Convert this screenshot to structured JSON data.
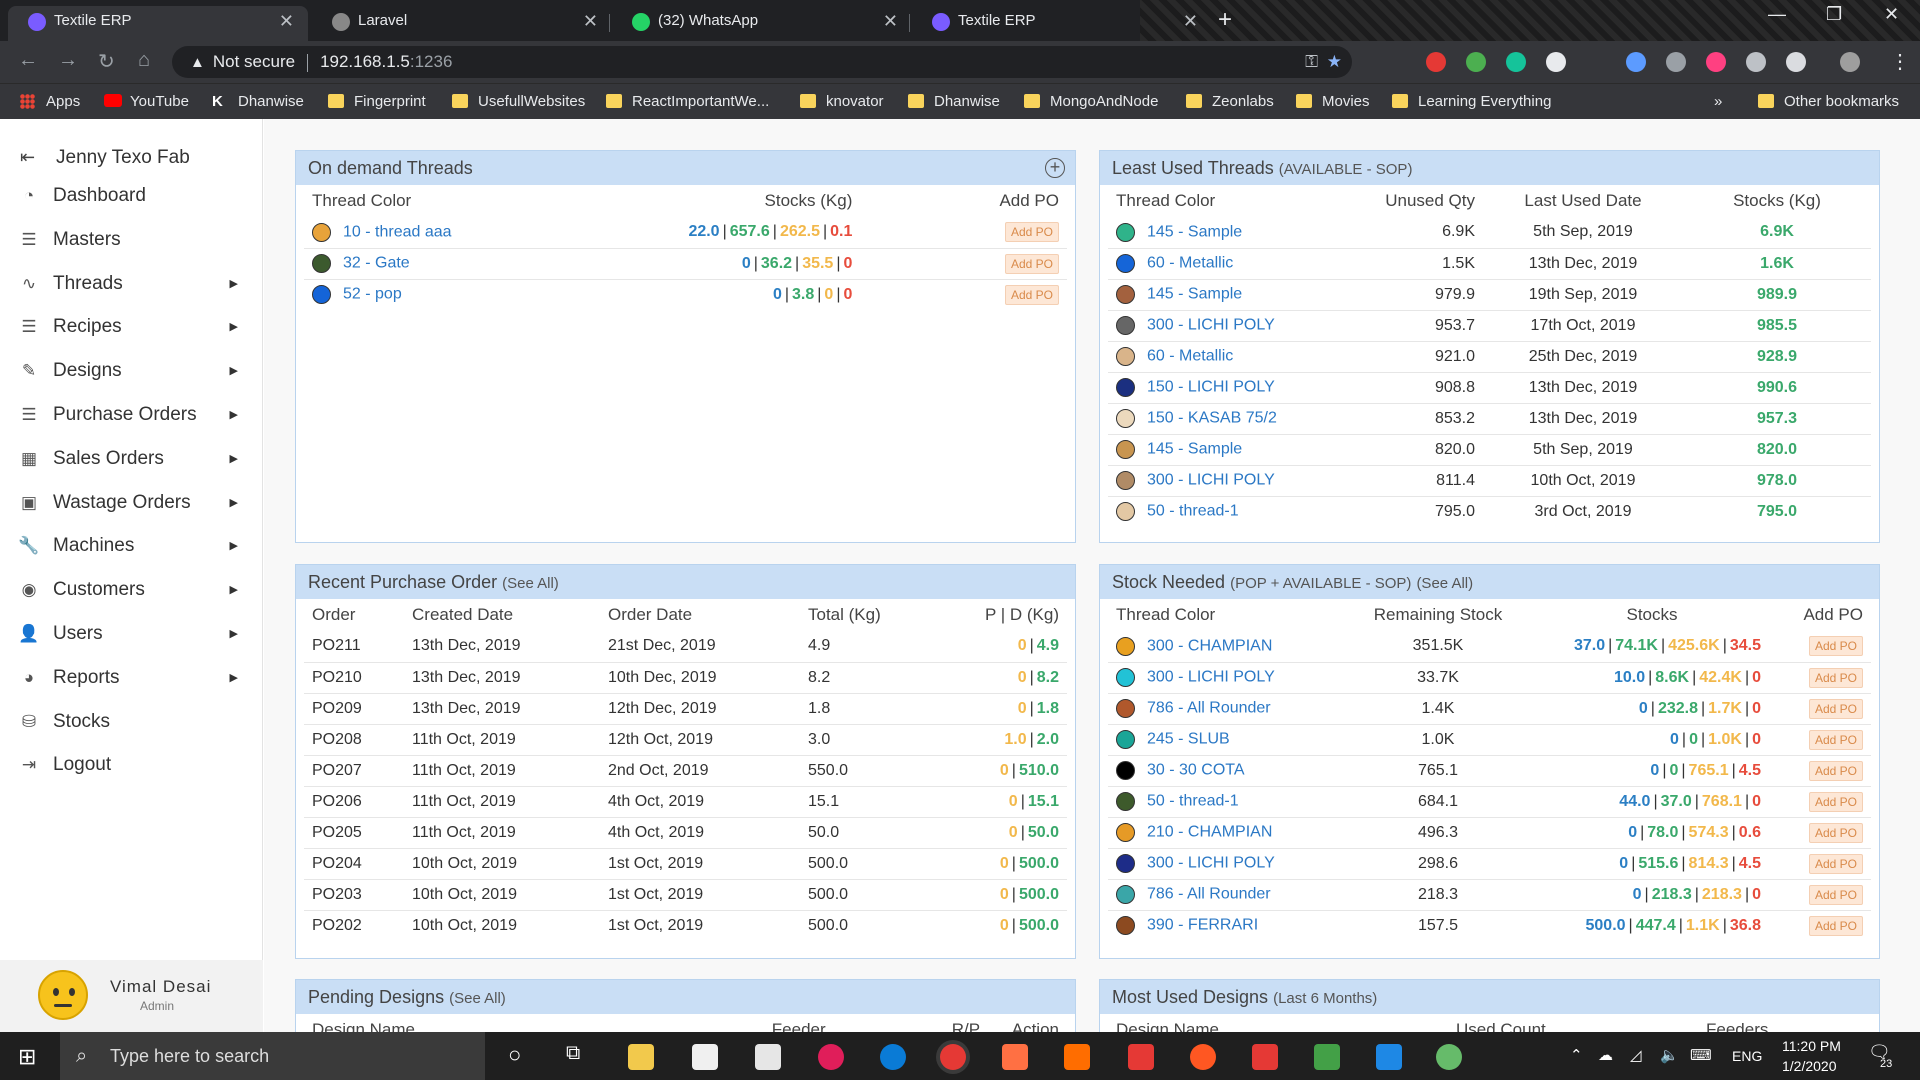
{
  "browser": {
    "tabs": [
      {
        "title": "Textile ERP"
      },
      {
        "title": "Laravel"
      },
      {
        "title": "(32) WhatsApp"
      },
      {
        "title": "Textile ERP"
      }
    ],
    "not_secure": "Not secure",
    "url_host": "192.168.1.5",
    "url_port": ":1236",
    "bookmarks": [
      "Apps",
      "YouTube",
      "Dhanwise",
      "Fingerprint",
      "UsefullWebsites",
      "ReactImportantWe...",
      "knovator",
      "Dhanwise",
      "MongoAndNode",
      "Zeonlabs",
      "Movies",
      "Learning Everything"
    ],
    "other_bookmarks": "Other bookmarks",
    "more": "»"
  },
  "sidebar": {
    "brand": "Jenny Texo Fab",
    "items": [
      {
        "label": "Dashboard",
        "icon": "dashboard-icon",
        "submenu": false
      },
      {
        "label": "Masters",
        "icon": "list-icon",
        "submenu": false
      },
      {
        "label": "Threads",
        "icon": "pulse-icon",
        "submenu": true
      },
      {
        "label": "Recipes",
        "icon": "list-icon",
        "submenu": true
      },
      {
        "label": "Designs",
        "icon": "pen-icon",
        "submenu": true
      },
      {
        "label": "Purchase Orders",
        "icon": "list-icon",
        "submenu": true
      },
      {
        "label": "Sales Orders",
        "icon": "grid-icon",
        "submenu": true
      },
      {
        "label": "Wastage Orders",
        "icon": "box-icon",
        "submenu": true
      },
      {
        "label": "Machines",
        "icon": "wrench-icon",
        "submenu": true
      },
      {
        "label": "Customers",
        "icon": "user-circle-icon",
        "submenu": true
      },
      {
        "label": "Users",
        "icon": "user-icon",
        "submenu": true
      },
      {
        "label": "Reports",
        "icon": "chart-icon",
        "submenu": true
      },
      {
        "label": "Stocks",
        "icon": "database-icon",
        "submenu": false
      },
      {
        "label": "Logout",
        "icon": "logout-icon",
        "submenu": false
      }
    ],
    "user": {
      "name": "Vimal Desai",
      "role": "Admin"
    }
  },
  "on_demand": {
    "title": "On demand Threads",
    "headers": [
      "Thread Color",
      "Stocks (Kg)",
      "Add PO"
    ],
    "rows": [
      {
        "color": "#e8a33a",
        "name": "10 - thread aaa",
        "s": [
          "22.0",
          "657.6",
          "262.5",
          "0.1"
        ],
        "btn": "Add PO"
      },
      {
        "color": "#3c5a2e",
        "name": "32 - Gate",
        "s": [
          "0",
          "36.2",
          "35.5",
          "0"
        ],
        "btn": "Add PO"
      },
      {
        "color": "#1464d8",
        "name": "52 - pop",
        "s": [
          "0",
          "3.8",
          "0",
          "0"
        ],
        "btn": "Add PO"
      }
    ]
  },
  "least_used": {
    "title": "Least Used Threads",
    "subtitle": "(AVAILABLE - SOP)",
    "headers": [
      "Thread Color",
      "Unused Qty",
      "Last Used Date",
      "Stocks (Kg)"
    ],
    "rows": [
      {
        "color": "#2fb38a",
        "name": "145 - Sample",
        "qty": "6.9K",
        "date": "5th Sep, 2019",
        "stock": "6.9K"
      },
      {
        "color": "#1565d8",
        "name": "60 - Metallic",
        "qty": "1.5K",
        "date": "13th Dec, 2019",
        "stock": "1.6K"
      },
      {
        "color": "#a3613e",
        "name": "145 - Sample",
        "qty": "979.9",
        "date": "19th Sep, 2019",
        "stock": "989.9"
      },
      {
        "color": "#666666",
        "name": "300 - LICHI POLY",
        "qty": "953.7",
        "date": "17th Oct, 2019",
        "stock": "985.5"
      },
      {
        "color": "#d9b48a",
        "name": "60 - Metallic",
        "qty": "921.0",
        "date": "25th Dec, 2019",
        "stock": "928.9"
      },
      {
        "color": "#1b2f80",
        "name": "150 - LICHI POLY",
        "qty": "908.8",
        "date": "13th Dec, 2019",
        "stock": "990.6"
      },
      {
        "color": "#ecd9bd",
        "name": "150 - KASAB 75/2",
        "qty": "853.2",
        "date": "13th Dec, 2019",
        "stock": "957.3"
      },
      {
        "color": "#c89550",
        "name": "145 - Sample",
        "qty": "820.0",
        "date": "5th Sep, 2019",
        "stock": "820.0"
      },
      {
        "color": "#b08b66",
        "name": "300 - LICHI POLY",
        "qty": "811.4",
        "date": "10th Oct, 2019",
        "stock": "978.0"
      },
      {
        "color": "#e3c8a4",
        "name": "50 - thread-1",
        "qty": "795.0",
        "date": "3rd Oct, 2019",
        "stock": "795.0"
      }
    ]
  },
  "recent_po": {
    "title": "Recent Purchase Order",
    "see_all": "(See All)",
    "headers": [
      "Order",
      "Created Date",
      "Order Date",
      "Total (Kg)",
      "P | D (Kg)"
    ],
    "rows": [
      {
        "order": "PO211",
        "created": "13th Dec, 2019",
        "date": "21st Dec, 2019",
        "total": "4.9",
        "p": "0",
        "d": "4.9"
      },
      {
        "order": "PO210",
        "created": "13th Dec, 2019",
        "date": "10th Dec, 2019",
        "total": "8.2",
        "p": "0",
        "d": "8.2"
      },
      {
        "order": "PO209",
        "created": "13th Dec, 2019",
        "date": "12th Dec, 2019",
        "total": "1.8",
        "p": "0",
        "d": "1.8"
      },
      {
        "order": "PO208",
        "created": "11th Oct, 2019",
        "date": "12th Oct, 2019",
        "total": "3.0",
        "p": "1.0",
        "d": "2.0"
      },
      {
        "order": "PO207",
        "created": "11th Oct, 2019",
        "date": "2nd Oct, 2019",
        "total": "550.0",
        "p": "0",
        "d": "510.0"
      },
      {
        "order": "PO206",
        "created": "11th Oct, 2019",
        "date": "4th Oct, 2019",
        "total": "15.1",
        "p": "0",
        "d": "15.1"
      },
      {
        "order": "PO205",
        "created": "11th Oct, 2019",
        "date": "4th Oct, 2019",
        "total": "50.0",
        "p": "0",
        "d": "50.0"
      },
      {
        "order": "PO204",
        "created": "10th Oct, 2019",
        "date": "1st Oct, 2019",
        "total": "500.0",
        "p": "0",
        "d": "500.0"
      },
      {
        "order": "PO203",
        "created": "10th Oct, 2019",
        "date": "1st Oct, 2019",
        "total": "500.0",
        "p": "0",
        "d": "500.0"
      },
      {
        "order": "PO202",
        "created": "10th Oct, 2019",
        "date": "1st Oct, 2019",
        "total": "500.0",
        "p": "0",
        "d": "500.0"
      }
    ]
  },
  "stock_needed": {
    "title": "Stock Needed",
    "subtitle": "(POP + AVAILABLE - SOP)",
    "see_all": "(See All)",
    "headers": [
      "Thread Color",
      "Remaining Stock",
      "Stocks",
      "Add PO"
    ],
    "rows": [
      {
        "color": "#e8a020",
        "name": "300 - CHAMPIAN",
        "rem": "351.5K",
        "s": [
          "37.0",
          "74.1K",
          "425.6K",
          "34.5"
        ],
        "btn": "Add PO"
      },
      {
        "color": "#22c2d6",
        "name": "300 - LICHI POLY",
        "rem": "33.7K",
        "s": [
          "10.0",
          "8.6K",
          "42.4K",
          "0"
        ],
        "btn": "Add PO"
      },
      {
        "color": "#b0582c",
        "name": "786 - All Rounder",
        "rem": "1.4K",
        "s": [
          "0",
          "232.8",
          "1.7K",
          "0"
        ],
        "btn": "Add PO"
      },
      {
        "color": "#1aa597",
        "name": "245 - SLUB",
        "rem": "1.0K",
        "s": [
          "0",
          "0",
          "1.0K",
          "0"
        ],
        "btn": "Add PO"
      },
      {
        "color": "#000000",
        "name": "30 - 30 COTA",
        "rem": "765.1",
        "s": [
          "0",
          "0",
          "765.1",
          "4.5"
        ],
        "btn": "Add PO"
      },
      {
        "color": "#3d5a2b",
        "name": "50 - thread-1",
        "rem": "684.1",
        "s": [
          "44.0",
          "37.0",
          "768.1",
          "0"
        ],
        "btn": "Add PO"
      },
      {
        "color": "#e69a26",
        "name": "210 - CHAMPIAN",
        "rem": "496.3",
        "s": [
          "0",
          "78.0",
          "574.3",
          "0.6"
        ],
        "btn": "Add PO"
      },
      {
        "color": "#1d2c88",
        "name": "300 - LICHI POLY",
        "rem": "298.6",
        "s": [
          "0",
          "515.6",
          "814.3",
          "4.5"
        ],
        "btn": "Add PO"
      },
      {
        "color": "#3aa6a8",
        "name": "786 - All Rounder",
        "rem": "218.3",
        "s": [
          "0",
          "218.3",
          "218.3",
          "0"
        ],
        "btn": "Add PO"
      },
      {
        "color": "#8c4a20",
        "name": "390 - FERRARI",
        "rem": "157.5",
        "s": [
          "500.0",
          "447.4",
          "1.1K",
          "36.8"
        ],
        "btn": "Add PO"
      }
    ]
  },
  "pending_designs": {
    "title": "Pending Designs",
    "see_all": "(See All)",
    "headers": [
      "Design Name",
      "Feeder",
      "R/P",
      "Action"
    ]
  },
  "most_used": {
    "title": "Most Used Designs",
    "subtitle": "(Last 6 Months)",
    "headers": [
      "Design Name",
      "Used Count",
      "Feeders"
    ]
  },
  "taskbar": {
    "search": "Type here to search",
    "lang": "ENG",
    "time": "11:20 PM",
    "date": "1/2/2020",
    "notif": "23"
  }
}
